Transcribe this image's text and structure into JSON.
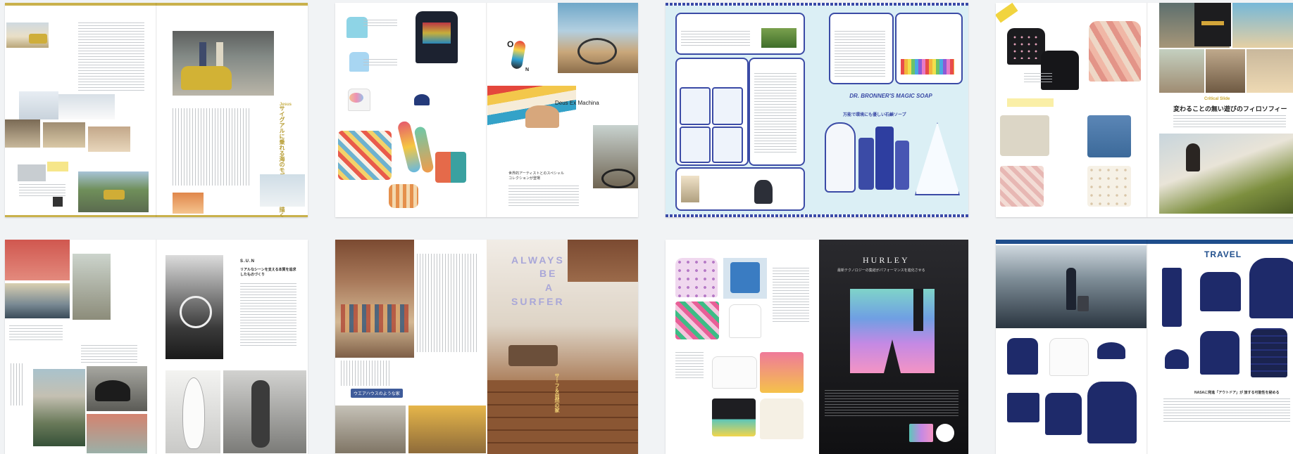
{
  "tiles": [
    {
      "name": "spread-1",
      "texts": {
        "headline_vertical": "サイグアルに乗れる海のモデルの日常を描く",
        "tag": "Jesus"
      }
    },
    {
      "name": "spread-2",
      "texts": {
        "brand": "Deus Ex Machina",
        "tagline": "世界的アーティストとのスペシャルコレクションが登場"
      }
    },
    {
      "name": "spread-3",
      "texts": {
        "product": "DR. BRONNER'S MAGIC SOAP",
        "headline": "万能で環境にも優しい石鹸ソープ"
      }
    },
    {
      "name": "spread-4",
      "texts": {
        "subtitle": "Critical Slide",
        "headline": "変わることの無い遊びのフィロソフィー"
      }
    },
    {
      "name": "spread-5",
      "texts": {
        "brand": "S.U.N",
        "headline": "リアルなシーンを支える本質を追求したものづくり"
      }
    },
    {
      "name": "spread-6",
      "texts": {
        "headline_line1": "ALWAYS",
        "headline_line2": "BE",
        "headline_line3": "A",
        "headline_line4": "SURFER",
        "banner": "ウエアハウスのような家",
        "vertical": "サーフ＆自然の家"
      }
    },
    {
      "name": "spread-7",
      "texts": {
        "brand": "HURLEY",
        "subtitle": "最新テクノロジーの集結がパフォーマンスを進化させる"
      }
    },
    {
      "name": "spread-8",
      "texts": {
        "title": "TRAVEL",
        "caption": "NASAに発進「アウトドア」が 旅する可能性を秘める"
      }
    }
  ],
  "colors": {
    "gold": "#c9b14c",
    "navy": "#1f2a6e",
    "blue": "#3b4ba6",
    "pink": "#e97ab4",
    "teal": "#77c9c4"
  }
}
